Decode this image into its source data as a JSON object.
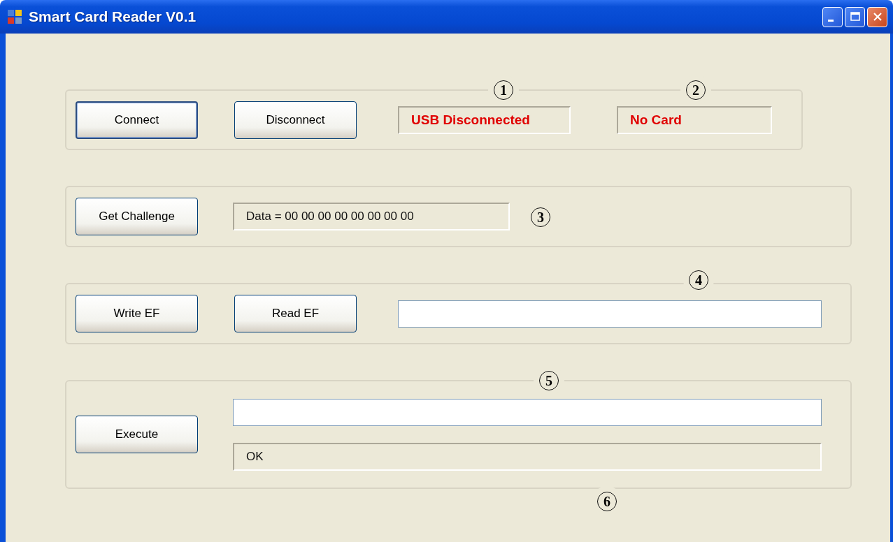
{
  "window": {
    "title": "Smart Card Reader V0.1"
  },
  "groups": [
    {
      "controls": [
        {
          "kind": "button",
          "label": "Connect",
          "focused": true
        },
        {
          "kind": "button",
          "label": "Disconnect",
          "focused": false
        },
        {
          "kind": "alert_label",
          "text": "USB Disconnected"
        },
        {
          "kind": "alert_label",
          "text": "No Card"
        }
      ],
      "callouts": [
        "1",
        "2"
      ]
    },
    {
      "controls": [
        {
          "kind": "button",
          "label": "Get Challenge",
          "focused": false
        },
        {
          "kind": "label",
          "text": "Data = 00 00 00 00 00 00 00 00"
        }
      ],
      "callouts": [
        "3"
      ]
    },
    {
      "controls": [
        {
          "kind": "button",
          "label": "Write EF",
          "focused": false
        },
        {
          "kind": "button",
          "label": "Read EF",
          "focused": false
        },
        {
          "kind": "input"
        }
      ],
      "callouts": [
        "4"
      ]
    },
    {
      "controls": [
        {
          "kind": "button",
          "label": "Execute",
          "focused": false
        },
        {
          "kind": "input"
        },
        {
          "kind": "label",
          "text": "OK"
        }
      ],
      "callouts": [
        "5",
        "6"
      ]
    }
  ]
}
